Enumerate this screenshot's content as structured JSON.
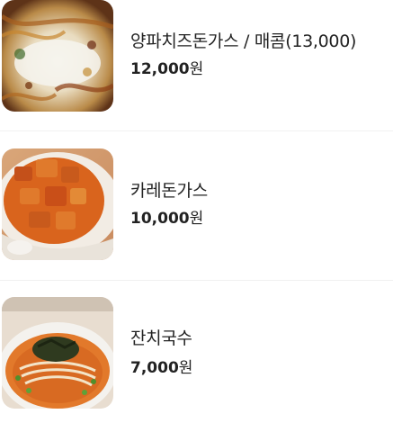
{
  "menu": {
    "items": [
      {
        "name": "양파치즈돈가스 / 매콤(13,000)",
        "price": "12,000",
        "currency": "원",
        "image_icon": "onion-cheese-cutlet-photo"
      },
      {
        "name": "카레돈가스",
        "price": "10,000",
        "currency": "원",
        "image_icon": "curry-cutlet-photo"
      },
      {
        "name": "잔치국수",
        "price": "7,000",
        "currency": "원",
        "image_icon": "banquet-noodles-photo"
      }
    ]
  }
}
